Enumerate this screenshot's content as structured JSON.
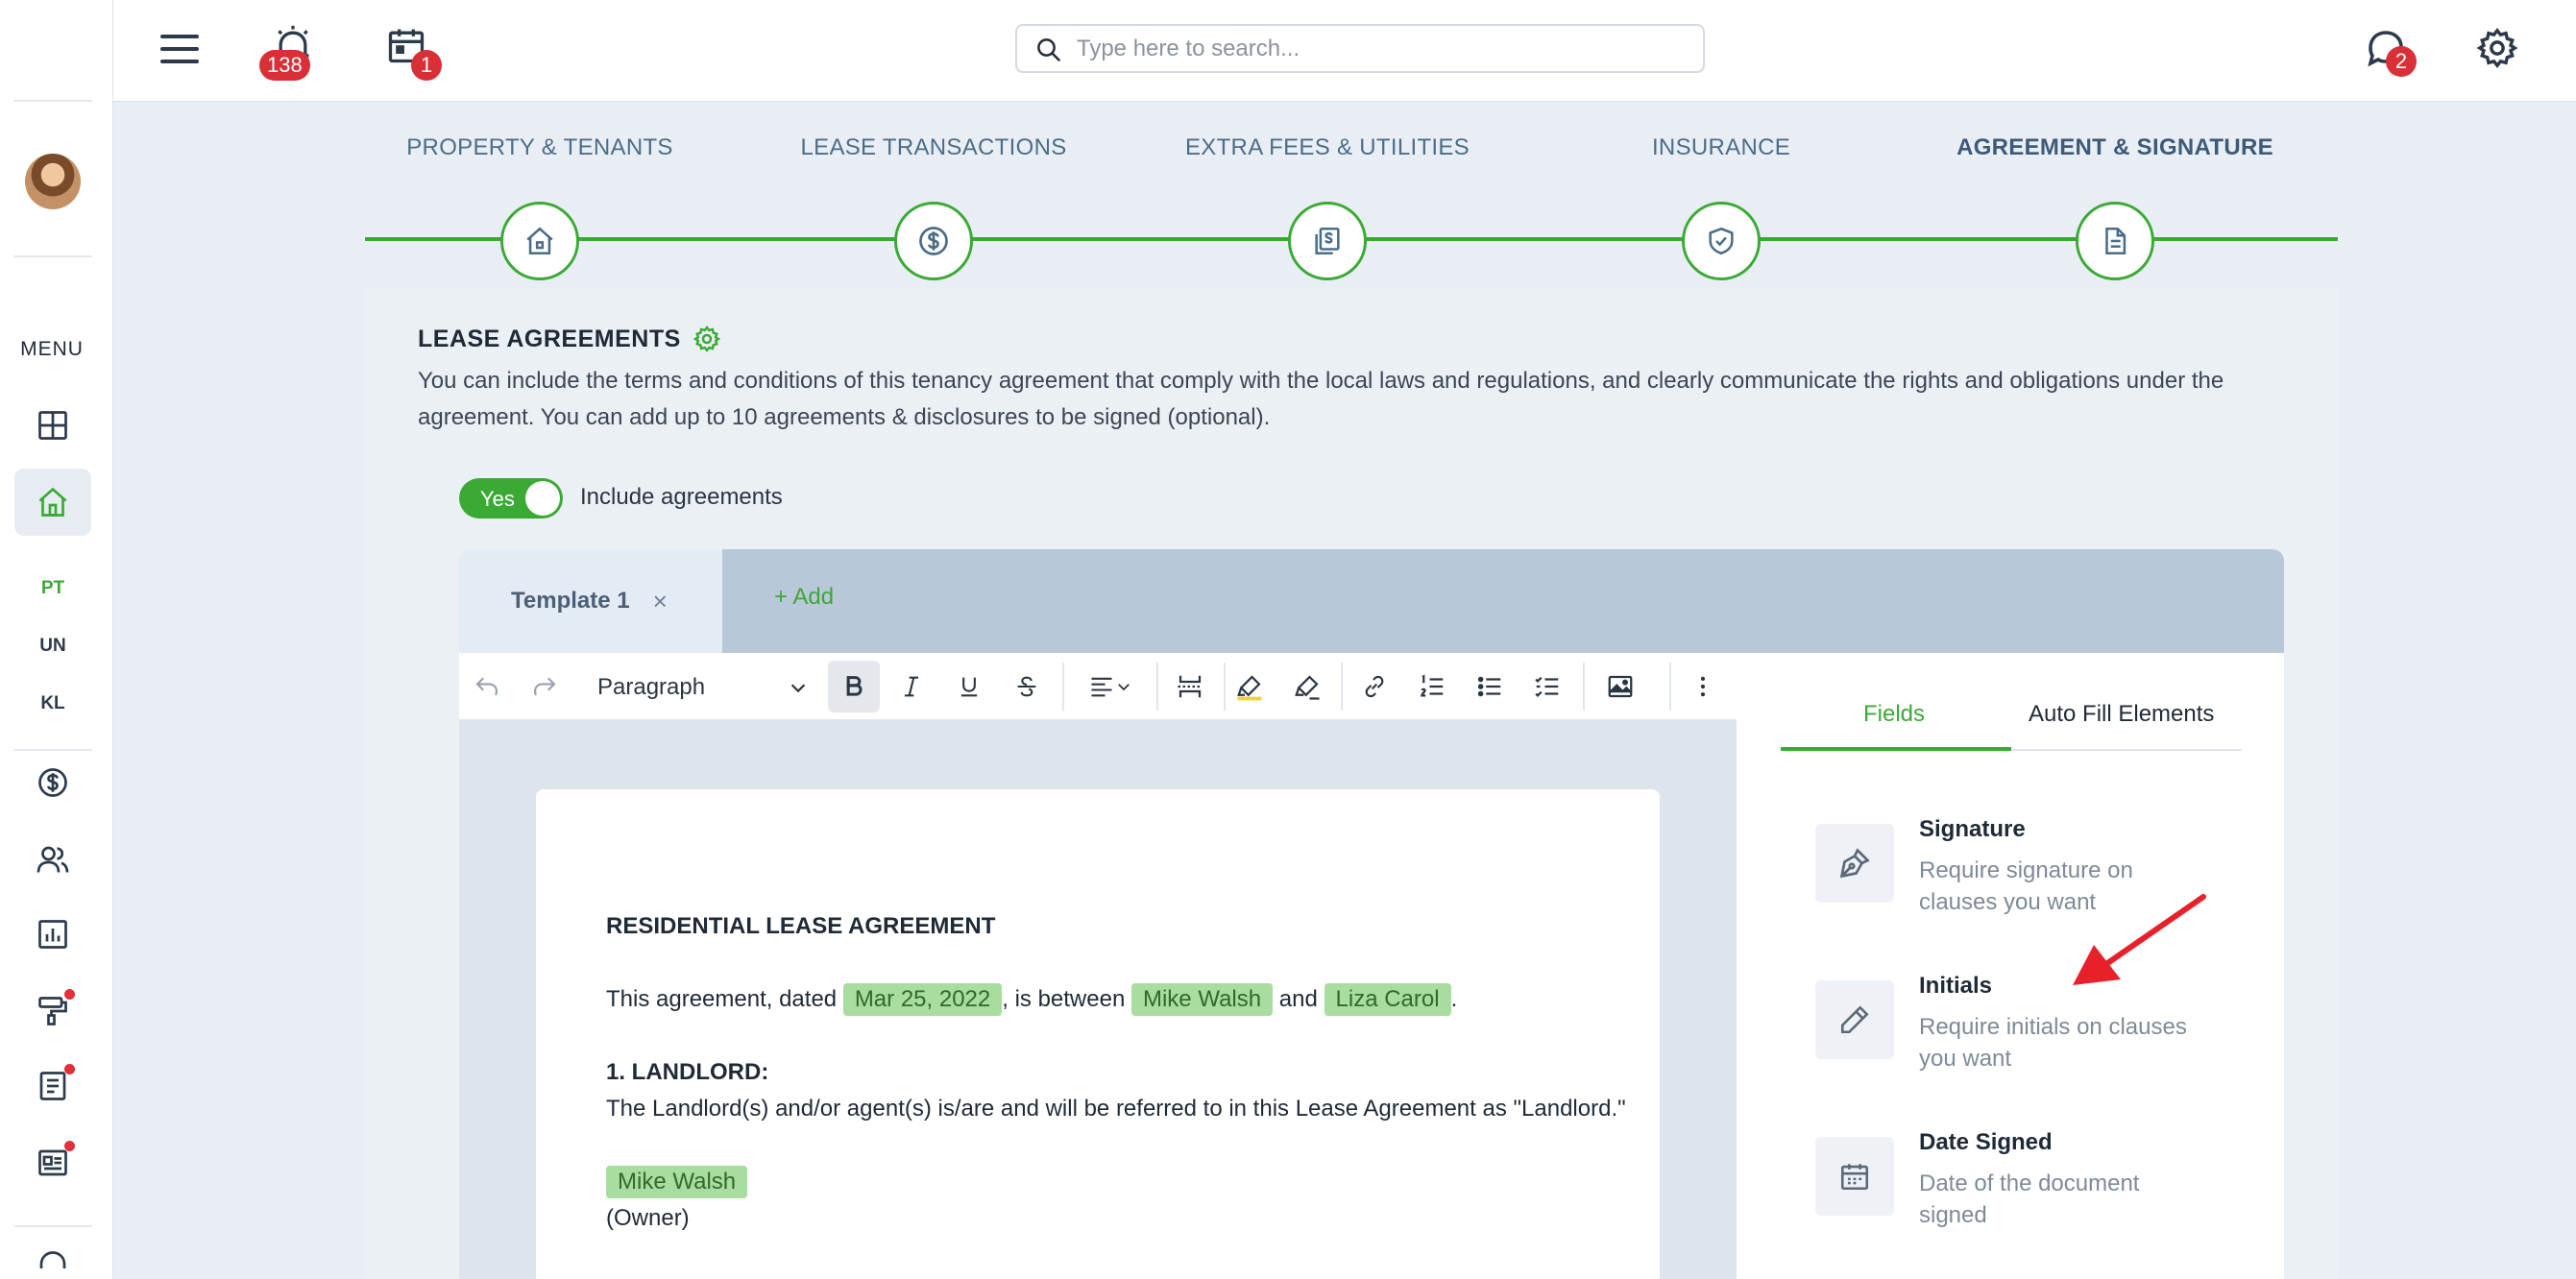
{
  "topbar": {
    "alarm_badge": "138",
    "calendar_badge": "1",
    "search_placeholder": "Type here to search...",
    "chat_badge": "2"
  },
  "sidebar": {
    "menu_label": "MENU",
    "abbreviations": [
      "PT",
      "UN",
      "KL"
    ]
  },
  "stepper": {
    "steps": [
      {
        "label": "PROPERTY & TENANTS",
        "icon": "house-icon"
      },
      {
        "label": "LEASE TRANSACTIONS",
        "icon": "dollar-circle-icon"
      },
      {
        "label": "EXTRA FEES & UTILITIES",
        "icon": "fees-document-icon"
      },
      {
        "label": "INSURANCE",
        "icon": "shield-check-icon"
      },
      {
        "label": "AGREEMENT & SIGNATURE",
        "icon": "document-icon"
      }
    ],
    "active_step": 4
  },
  "lease": {
    "title": "LEASE AGREEMENTS",
    "description": "You can include the terms and conditions of this tenancy agreement that comply with the local laws and regulations, and clearly communicate the rights and obligations under the agreement. You can add up to 10 agreements & disclosures to be signed (optional).",
    "toggle_value": "Yes",
    "toggle_label": "Include agreements"
  },
  "templates": {
    "active_tab": "Template 1",
    "close_symbol": "×",
    "add_label": "+ Add"
  },
  "toolbar": {
    "paragraph_style": "Paragraph"
  },
  "document": {
    "heading": "RESIDENTIAL LEASE AGREEMENT",
    "line1_prefix": "This agreement, dated ",
    "date_chip": "Mar 25, 2022",
    "line1_mid": ", is between ",
    "party1_chip": "Mike Walsh",
    "line1_and": " and ",
    "party2_chip": "Liza Carol",
    "line1_end": ".",
    "section1_title": "1. LANDLORD:",
    "section1_text": "The Landlord(s) and/or agent(s) is/are and will be referred to in this Lease Agreement as \"Landlord.\"",
    "owner_chip": "Mike Walsh",
    "owner_label": "(Owner)"
  },
  "fields_panel": {
    "tabs": [
      "Fields",
      "Auto Fill Elements"
    ],
    "items": [
      {
        "name": "Signature",
        "description": "Require signature on clauses you want",
        "icon": "signature-pen-icon"
      },
      {
        "name": "Initials",
        "description": "Require initials on clauses you want",
        "icon": "pencil-icon"
      },
      {
        "name": "Date Signed",
        "description": "Date of the document signed",
        "icon": "calendar-icon"
      }
    ]
  },
  "colors": {
    "accent_green": "#3aaa35",
    "badge_red": "#d92f36",
    "arrow_red": "#e8202a"
  }
}
